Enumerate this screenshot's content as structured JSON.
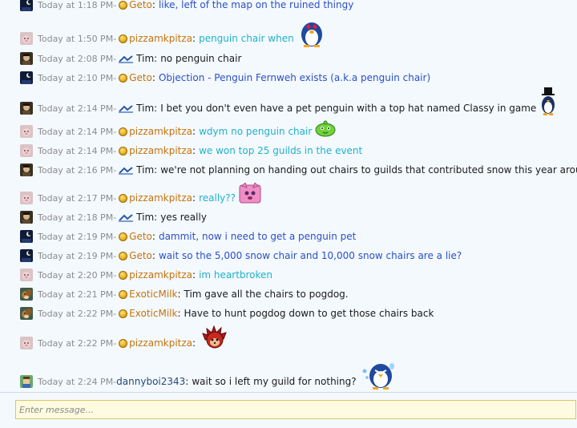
{
  "separator": " - ",
  "input": {
    "placeholder": "Enter message..."
  },
  "colors": {
    "timestamp": "#8c8c8c",
    "user_orange": "#c7720b",
    "msg_blue": "#2b4fc6",
    "msg_cyan": "#1fb2c9",
    "msg_black": "#1a1a1a",
    "user_dark_blue": "#25487c"
  },
  "messages": [
    {
      "time": "Today at 1:18 PM",
      "user": "Geto",
      "badge": "coin-badge",
      "avatar": "night-avatar",
      "text": "like, left of the map on the ruined thingy",
      "user_color": "#c7720b",
      "text_color": "#2b4fc6"
    },
    {
      "time": "Today at 1:50 PM",
      "user": "pizzamkpitza",
      "badge": "coin-badge",
      "avatar": "pig-avatar",
      "text": "penguin chair when",
      "emote": "penguin-love-emote",
      "user_color": "#c7720b",
      "text_color": "#1fb2c9"
    },
    {
      "time": "Today at 2:08 PM",
      "user": "Tim",
      "badge": "staff-badge",
      "avatar": "dark-char-avatar",
      "text": "no penguin chair",
      "user_color": "#1a1a1a",
      "text_color": "#1a1a1a"
    },
    {
      "time": "Today at 2:10 PM",
      "user": "Geto",
      "badge": "coin-badge",
      "avatar": "night-avatar",
      "text": "Objection - Penguin Fernweh exists (a.k.a penguin chair)",
      "user_color": "#c7720b",
      "text_color": "#2b4fc6"
    },
    {
      "time": "Today at 2:14 PM",
      "user": "Tim",
      "badge": "staff-badge",
      "avatar": "dark-char-avatar",
      "text": "I bet you don't even have a pet penguin with a top hat named Classy in game",
      "emote": "penguin-tophat-emote",
      "user_color": "#1a1a1a",
      "text_color": "#1a1a1a"
    },
    {
      "time": "Today at 2:14 PM",
      "user": "pizzamkpitza",
      "badge": "coin-badge",
      "avatar": "pig-avatar",
      "text": "wdym no penguin chair",
      "emote": "green-slime-emote",
      "user_color": "#c7720b",
      "text_color": "#1fb2c9"
    },
    {
      "time": "Today at 2:14 PM",
      "user": "pizzamkpitza",
      "badge": "coin-badge",
      "avatar": "pig-avatar",
      "text": "we won top 25 guilds in the event",
      "user_color": "#c7720b",
      "text_color": "#1fb2c9"
    },
    {
      "time": "Today at 2:16 PM",
      "user": "Tim",
      "badge": "staff-badge",
      "avatar": "dark-char-avatar",
      "text": "we're not planning on handing out chairs to guilds that contributed snow this year around",
      "user_color": "#1a1a1a",
      "text_color": "#1a1a1a"
    },
    {
      "time": "Today at 2:17 PM",
      "user": "pizzamkpitza",
      "badge": "coin-badge",
      "avatar": "pig-avatar",
      "text": "really??",
      "emote": "pink-cat-emote",
      "user_color": "#c7720b",
      "text_color": "#1fb2c9"
    },
    {
      "time": "Today at 2:18 PM",
      "user": "Tim",
      "badge": "staff-badge",
      "avatar": "dark-char-avatar",
      "text": "yes really",
      "user_color": "#1a1a1a",
      "text_color": "#1a1a1a"
    },
    {
      "time": "Today at 2:19 PM",
      "user": "Geto",
      "badge": "coin-badge",
      "avatar": "night-avatar",
      "text": "dammit, now i need to get a penguin pet",
      "user_color": "#c7720b",
      "text_color": "#2b4fc6"
    },
    {
      "time": "Today at 2:19 PM",
      "user": "Geto",
      "badge": "coin-badge",
      "avatar": "night-avatar",
      "text": "wait so the 5,000 snow chair and 10,000 snow chairs are a lie?",
      "user_color": "#c7720b",
      "text_color": "#2b4fc6"
    },
    {
      "time": "Today at 2:20 PM",
      "user": "pizzamkpitza",
      "badge": "coin-badge",
      "avatar": "pig-avatar",
      "text": "im heartbroken",
      "user_color": "#c7720b",
      "text_color": "#1fb2c9"
    },
    {
      "time": "Today at 2:21 PM",
      "user": "ExoticMilk",
      "badge": "coin-badge",
      "avatar": "squirrel-avatar",
      "text": "Tim gave all the chairs to pogdog.",
      "user_color": "#c7720b",
      "text_color": "#1a1a1a"
    },
    {
      "time": "Today at 2:22 PM",
      "user": "ExoticMilk",
      "badge": "coin-badge",
      "avatar": "squirrel-avatar",
      "text": "Have to hunt pogdog down to get those chairs back",
      "user_color": "#c7720b",
      "text_color": "#1a1a1a"
    },
    {
      "time": "Today at 2:22 PM",
      "user": "pizzamkpitza",
      "badge": "coin-badge",
      "avatar": "pig-avatar",
      "text": "",
      "emote": "red-hedgehog-emote",
      "user_color": "#c7720b",
      "text_color": "#1fb2c9"
    },
    {
      "time": "Today at 2:24 PM",
      "user": "dannyboi2343",
      "badge": "none",
      "avatar": "blocky-avatar",
      "text": "wait so i left my guild for nothing?",
      "emote": "penguin-sweat-emote",
      "user_color": "#25487c",
      "text_color": "#1a1a1a"
    }
  ]
}
